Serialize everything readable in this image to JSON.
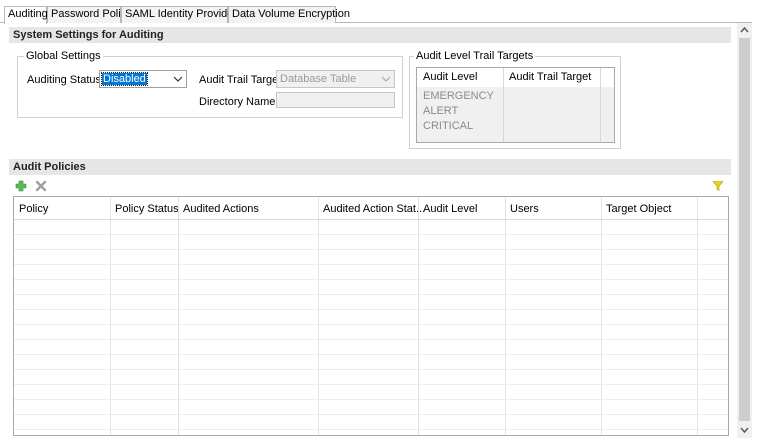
{
  "tabs": [
    {
      "label": "Auditing",
      "active": true
    },
    {
      "label": "Password Policy",
      "active": false
    },
    {
      "label": "SAML Identity Providers",
      "active": false
    },
    {
      "label": "Data Volume Encryption",
      "active": false
    }
  ],
  "system_settings": {
    "title": "System Settings for Auditing",
    "global_settings": {
      "title": "Global Settings",
      "auditing_status_label": "Auditing Status:",
      "auditing_status_value": "Disabled",
      "audit_trail_target_label": "Audit Trail Target:",
      "audit_trail_target_value": "Database Table",
      "directory_name_label": "Directory Name:",
      "directory_name_value": ""
    },
    "audit_level_trail_targets": {
      "title": "Audit Level Trail Targets",
      "columns": [
        "Audit Level",
        "Audit Trail Target"
      ],
      "rows": [
        {
          "level": "EMERGENCY",
          "target": ""
        },
        {
          "level": "ALERT",
          "target": ""
        },
        {
          "level": "CRITICAL",
          "target": ""
        }
      ]
    }
  },
  "audit_policies": {
    "title": "Audit Policies",
    "add_icon": "plus-icon",
    "delete_icon": "x-icon",
    "filter_icon": "funnel-icon",
    "columns": [
      "Policy",
      "Policy Status",
      "Audited Actions",
      "Audited Action Stat...",
      "Audit Level",
      "Users",
      "Target Object"
    ],
    "rows": []
  },
  "colors": {
    "add_icon": "#4caf50",
    "delete_icon": "#9e9e9e",
    "filter_icon": "#e8c400",
    "selection": "#0078d7"
  }
}
